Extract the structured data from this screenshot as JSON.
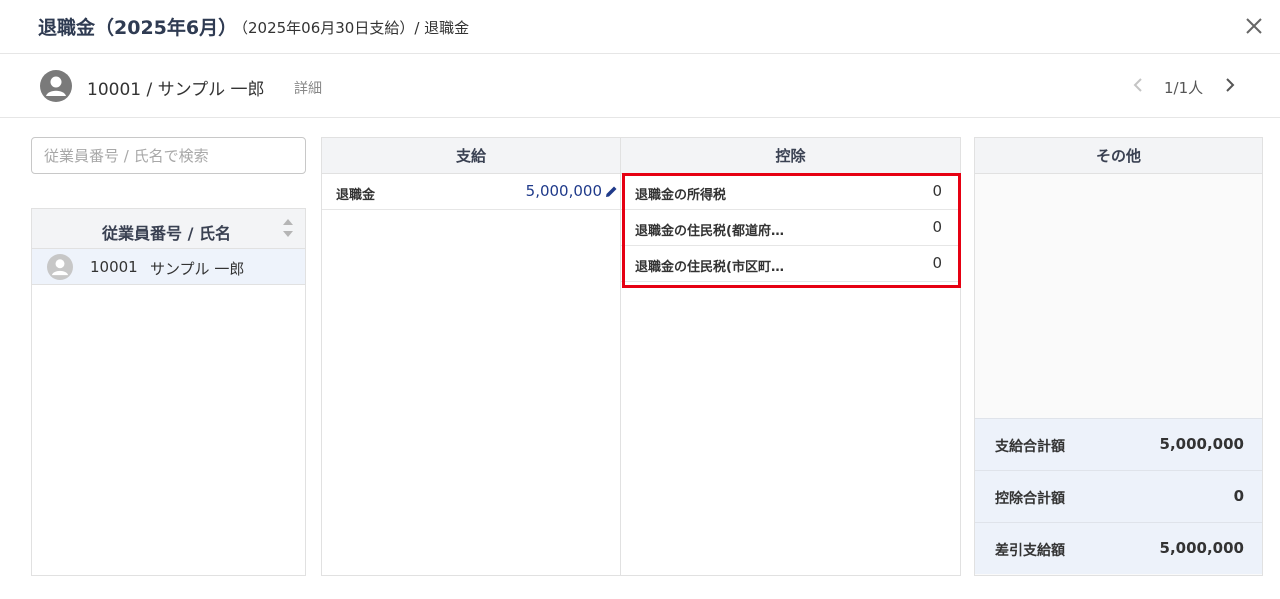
{
  "header": {
    "title": "退職金（2025年6月）",
    "subtitle": "（2025年06月30日支給）/ 退職金"
  },
  "employee_bar": {
    "name": "10001 / サンプル 一郎",
    "detail_link": "詳細",
    "pager": "1/1人"
  },
  "sidebar": {
    "search_placeholder": "従業員番号 / 氏名で検索",
    "list_header": "従業員番号 / 氏名",
    "employees": [
      {
        "id": "10001",
        "name": "サンプル 一郎"
      }
    ]
  },
  "payments": {
    "header": "支給",
    "items": [
      {
        "label": "退職金",
        "value": "5,000,000"
      }
    ]
  },
  "deductions": {
    "header": "控除",
    "items": [
      {
        "label": "退職金の所得税",
        "value": "0"
      },
      {
        "label": "退職金の住民税(都道府…",
        "value": "0"
      },
      {
        "label": "退職金の住民税(市区町…",
        "value": "0"
      }
    ]
  },
  "other": {
    "header": "その他",
    "summary": [
      {
        "label": "支給合計額",
        "value": "5,000,000"
      },
      {
        "label": "控除合計額",
        "value": "0"
      },
      {
        "label": "差引支給額",
        "value": "5,000,000"
      }
    ]
  },
  "colors": {
    "highlight_border": "#e60012",
    "link_value": "#1f3a8a",
    "header_text": "#2f3b52",
    "selected_row": "#eef3fb",
    "summary_bg": "#edf2fa"
  },
  "icons": [
    "close-icon",
    "user-avatar-icon",
    "chevron-left-icon",
    "chevron-right-icon",
    "sort-icon",
    "pencil-icon"
  ]
}
